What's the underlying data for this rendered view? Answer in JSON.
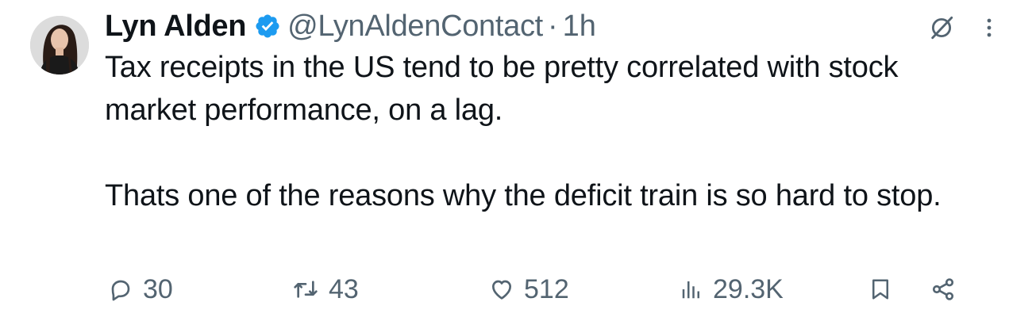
{
  "author": {
    "name": "Lyn Alden",
    "handle": "@LynAldenContact",
    "separator": "·",
    "time": "1h",
    "verified_color": "#1d9bf0"
  },
  "tweet": {
    "paragraphs": [
      "Tax receipts in the US tend to be pretty correlated with stock market performance, on a lag.",
      "Thats one of the reasons why the deficit train is so hard to stop."
    ]
  },
  "actions": {
    "replies": "30",
    "reposts": "43",
    "likes": "512",
    "views": "29.3K"
  },
  "icons": {
    "reply": "reply-icon",
    "repost": "repost-icon",
    "like": "like-icon",
    "views": "views-icon",
    "bookmark": "bookmark-icon",
    "share": "share-icon",
    "grok": "grok-icon",
    "more": "more-icon"
  },
  "colors": {
    "text": "#0f1419",
    "muted": "#536471",
    "accent": "#1d9bf0"
  }
}
